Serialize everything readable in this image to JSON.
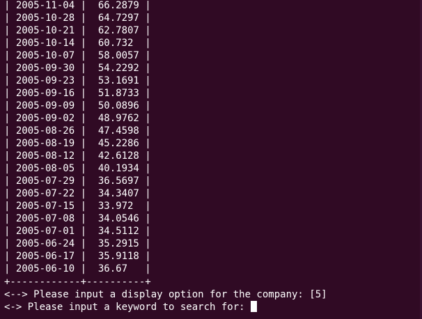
{
  "terminal": {
    "rows": [
      "| 2005-11-04 |  66.2879 |",
      "| 2005-10-28 |  64.7297 |",
      "| 2005-10-21 |  62.7807 |",
      "| 2005-10-14 |  60.732  |",
      "| 2005-10-07 |  58.0057 |",
      "| 2005-09-30 |  54.2292 |",
      "| 2005-09-23 |  53.1691 |",
      "| 2005-09-16 |  51.8733 |",
      "| 2005-09-09 |  50.0896 |",
      "| 2005-09-02 |  48.9762 |",
      "| 2005-08-26 |  47.4598 |",
      "| 2005-08-19 |  45.2286 |",
      "| 2005-08-12 |  42.6128 |",
      "| 2005-08-05 |  40.1934 |",
      "| 2005-07-29 |  36.5697 |",
      "| 2005-07-22 |  34.3407 |",
      "| 2005-07-15 |  33.972  |",
      "| 2005-07-08 |  34.0546 |",
      "| 2005-07-01 |  34.5112 |",
      "| 2005-06-24 |  35.2915 |",
      "| 2005-06-17 |  35.9118 |",
      "| 2005-06-10 |  36.67   |",
      "+------------+----------+",
      "<--> Please input a display option for the company: [5]",
      "<-> Please input a keyword to search for: "
    ]
  },
  "colors": {
    "background": "#300a24",
    "text": "#ffffff",
    "cursor": "#ffffff"
  }
}
